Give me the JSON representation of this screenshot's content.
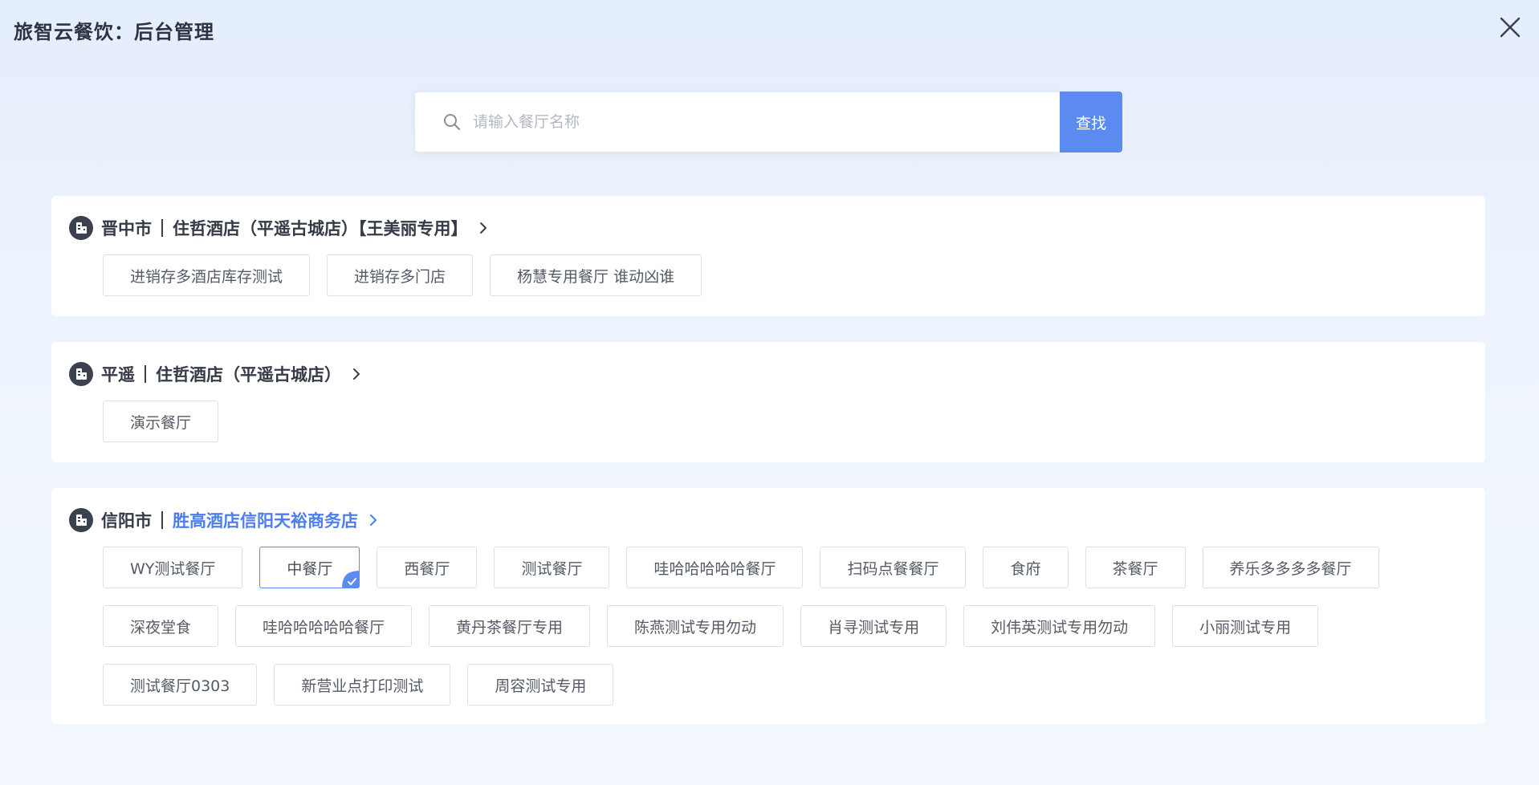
{
  "header": {
    "title": "旅智云餐饮：后台管理"
  },
  "search": {
    "placeholder": "请输入餐厅名称",
    "value": "",
    "button_label": "查找"
  },
  "groups": [
    {
      "city": "晋中市",
      "hotel": "住哲酒店（平遥古城店）【王美丽专用】",
      "restaurants": [
        "进销存多酒店库存测试",
        "进销存多门店",
        "杨慧专用餐厅 谁动凶谁"
      ]
    },
    {
      "city": "平遥",
      "hotel": "住哲酒店（平遥古城店）",
      "restaurants": [
        "演示餐厅"
      ]
    },
    {
      "city": "信阳市",
      "hotel": "胜高酒店信阳天裕商务店",
      "restaurants": [
        "WY测试餐厅",
        "中餐厅",
        "西餐厅",
        "测试餐厅",
        "哇哈哈哈哈哈餐厅",
        "扫码点餐餐厅",
        "食府",
        "茶餐厅",
        "养乐多多多多餐厅",
        "深夜堂食",
        "哇哈哈哈哈哈餐厅",
        "黄丹茶餐厅专用",
        "陈燕测试专用勿动",
        "肖寻测试专用",
        "刘伟英测试专用勿动",
        "小丽测试专用",
        "测试餐厅0303",
        "新营业点打印测试",
        "周容测试专用"
      ]
    }
  ],
  "icons": {
    "close": "close-icon",
    "search": "search-icon",
    "group": "building-icon",
    "expand": "chevron-right-icon",
    "selected": "check-corner-icon"
  },
  "colors": {
    "accent": "#5b8af0",
    "active_hotel": "#4d7ef0"
  }
}
